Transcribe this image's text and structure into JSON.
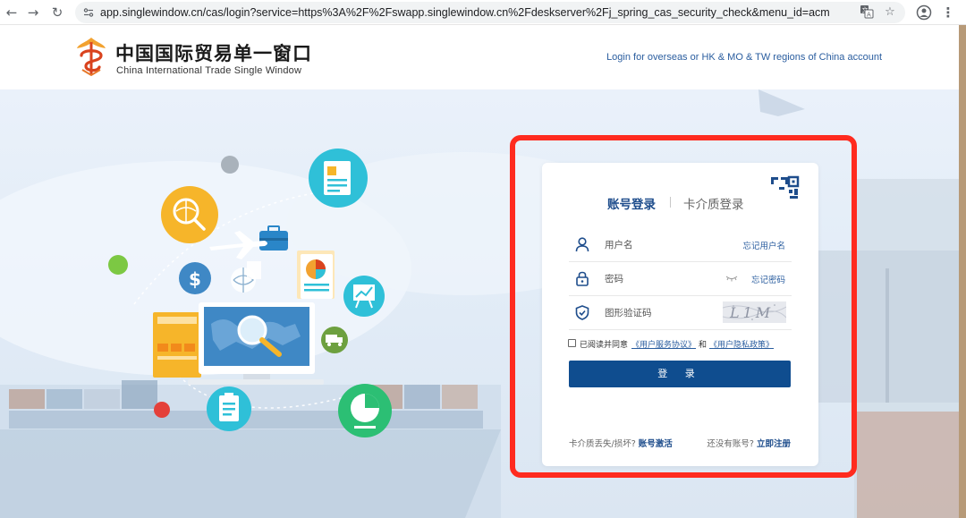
{
  "browser": {
    "url": "app.singlewindow.cn/cas/login?service=https%3A%2F%2Fswapp.singlewindow.cn%2Fdeskserver%2Fj_spring_cas_security_check&menu_id=acm",
    "back_icon": "arrow-left-icon",
    "forward_icon": "arrow-right-icon",
    "reload_icon": "reload-icon",
    "site_settings_icon": "site-settings-icon",
    "translate_icon": "translate-icon",
    "bookmark_icon": "star-icon",
    "profile_icon": "profile-icon",
    "menu_icon": "kebab-menu-icon"
  },
  "header": {
    "logo_cn": "中国国际贸易单一窗口",
    "logo_en": "China International Trade Single Window",
    "overseas_link": "Login for overseas or HK & MO & TW regions of China account"
  },
  "login": {
    "tabs": [
      {
        "label": "账号登录",
        "active": true
      },
      {
        "label": "卡介质登录",
        "active": false
      }
    ],
    "username_placeholder": "用户名",
    "forgot_username": "忘记用户名",
    "password_placeholder": "密码",
    "forgot_password": "忘记密码",
    "captcha_placeholder": "图形验证码",
    "captcha_text": "L1M",
    "agree_prefix": "已阅读并同意",
    "service_agreement": "《用户服务协议》",
    "agree_and": "和",
    "privacy_policy": "《用户隐私政策》",
    "submit_label": "登 录",
    "card_lost_prefix": "卡介质丢失/损坏?",
    "activate_account": "账号激活",
    "no_account_prefix": "还没有账号?",
    "register_now": "立即注册"
  },
  "colors": {
    "primary": "#0f4d8f",
    "link": "#2a5d9f",
    "highlight_frame": "#ff2b1f"
  }
}
